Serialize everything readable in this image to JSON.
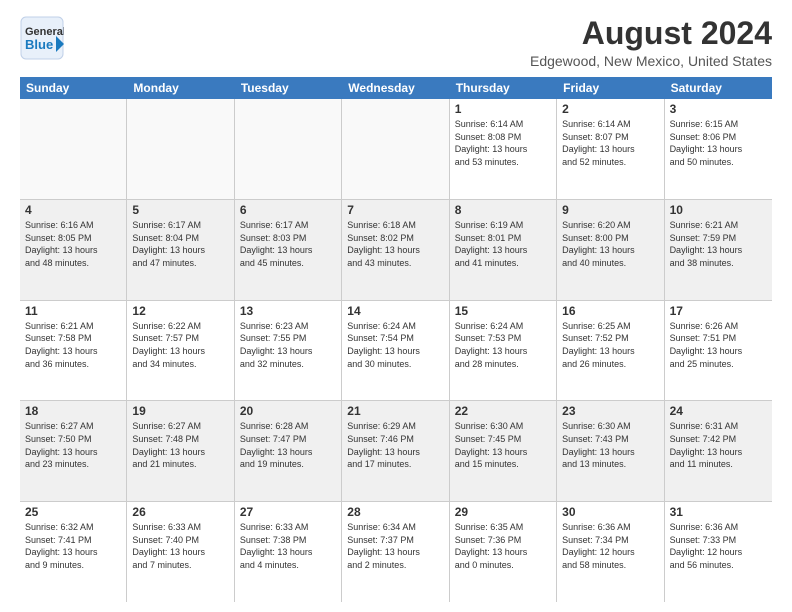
{
  "logo": {
    "line1": "General",
    "line2": "Blue"
  },
  "title": "August 2024",
  "location": "Edgewood, New Mexico, United States",
  "days_of_week": [
    "Sunday",
    "Monday",
    "Tuesday",
    "Wednesday",
    "Thursday",
    "Friday",
    "Saturday"
  ],
  "weeks": [
    [
      {
        "day": "",
        "info": "",
        "empty": true
      },
      {
        "day": "",
        "info": "",
        "empty": true
      },
      {
        "day": "",
        "info": "",
        "empty": true
      },
      {
        "day": "",
        "info": "",
        "empty": true
      },
      {
        "day": "1",
        "info": "Sunrise: 6:14 AM\nSunset: 8:08 PM\nDaylight: 13 hours\nand 53 minutes."
      },
      {
        "day": "2",
        "info": "Sunrise: 6:14 AM\nSunset: 8:07 PM\nDaylight: 13 hours\nand 52 minutes."
      },
      {
        "day": "3",
        "info": "Sunrise: 6:15 AM\nSunset: 8:06 PM\nDaylight: 13 hours\nand 50 minutes."
      }
    ],
    [
      {
        "day": "4",
        "info": "Sunrise: 6:16 AM\nSunset: 8:05 PM\nDaylight: 13 hours\nand 48 minutes."
      },
      {
        "day": "5",
        "info": "Sunrise: 6:17 AM\nSunset: 8:04 PM\nDaylight: 13 hours\nand 47 minutes."
      },
      {
        "day": "6",
        "info": "Sunrise: 6:17 AM\nSunset: 8:03 PM\nDaylight: 13 hours\nand 45 minutes."
      },
      {
        "day": "7",
        "info": "Sunrise: 6:18 AM\nSunset: 8:02 PM\nDaylight: 13 hours\nand 43 minutes."
      },
      {
        "day": "8",
        "info": "Sunrise: 6:19 AM\nSunset: 8:01 PM\nDaylight: 13 hours\nand 41 minutes."
      },
      {
        "day": "9",
        "info": "Sunrise: 6:20 AM\nSunset: 8:00 PM\nDaylight: 13 hours\nand 40 minutes."
      },
      {
        "day": "10",
        "info": "Sunrise: 6:21 AM\nSunset: 7:59 PM\nDaylight: 13 hours\nand 38 minutes."
      }
    ],
    [
      {
        "day": "11",
        "info": "Sunrise: 6:21 AM\nSunset: 7:58 PM\nDaylight: 13 hours\nand 36 minutes."
      },
      {
        "day": "12",
        "info": "Sunrise: 6:22 AM\nSunset: 7:57 PM\nDaylight: 13 hours\nand 34 minutes."
      },
      {
        "day": "13",
        "info": "Sunrise: 6:23 AM\nSunset: 7:55 PM\nDaylight: 13 hours\nand 32 minutes."
      },
      {
        "day": "14",
        "info": "Sunrise: 6:24 AM\nSunset: 7:54 PM\nDaylight: 13 hours\nand 30 minutes."
      },
      {
        "day": "15",
        "info": "Sunrise: 6:24 AM\nSunset: 7:53 PM\nDaylight: 13 hours\nand 28 minutes."
      },
      {
        "day": "16",
        "info": "Sunrise: 6:25 AM\nSunset: 7:52 PM\nDaylight: 13 hours\nand 26 minutes."
      },
      {
        "day": "17",
        "info": "Sunrise: 6:26 AM\nSunset: 7:51 PM\nDaylight: 13 hours\nand 25 minutes."
      }
    ],
    [
      {
        "day": "18",
        "info": "Sunrise: 6:27 AM\nSunset: 7:50 PM\nDaylight: 13 hours\nand 23 minutes."
      },
      {
        "day": "19",
        "info": "Sunrise: 6:27 AM\nSunset: 7:48 PM\nDaylight: 13 hours\nand 21 minutes."
      },
      {
        "day": "20",
        "info": "Sunrise: 6:28 AM\nSunset: 7:47 PM\nDaylight: 13 hours\nand 19 minutes."
      },
      {
        "day": "21",
        "info": "Sunrise: 6:29 AM\nSunset: 7:46 PM\nDaylight: 13 hours\nand 17 minutes."
      },
      {
        "day": "22",
        "info": "Sunrise: 6:30 AM\nSunset: 7:45 PM\nDaylight: 13 hours\nand 15 minutes."
      },
      {
        "day": "23",
        "info": "Sunrise: 6:30 AM\nSunset: 7:43 PM\nDaylight: 13 hours\nand 13 minutes."
      },
      {
        "day": "24",
        "info": "Sunrise: 6:31 AM\nSunset: 7:42 PM\nDaylight: 13 hours\nand 11 minutes."
      }
    ],
    [
      {
        "day": "25",
        "info": "Sunrise: 6:32 AM\nSunset: 7:41 PM\nDaylight: 13 hours\nand 9 minutes."
      },
      {
        "day": "26",
        "info": "Sunrise: 6:33 AM\nSunset: 7:40 PM\nDaylight: 13 hours\nand 7 minutes."
      },
      {
        "day": "27",
        "info": "Sunrise: 6:33 AM\nSunset: 7:38 PM\nDaylight: 13 hours\nand 4 minutes."
      },
      {
        "day": "28",
        "info": "Sunrise: 6:34 AM\nSunset: 7:37 PM\nDaylight: 13 hours\nand 2 minutes."
      },
      {
        "day": "29",
        "info": "Sunrise: 6:35 AM\nSunset: 7:36 PM\nDaylight: 13 hours\nand 0 minutes."
      },
      {
        "day": "30",
        "info": "Sunrise: 6:36 AM\nSunset: 7:34 PM\nDaylight: 12 hours\nand 58 minutes."
      },
      {
        "day": "31",
        "info": "Sunrise: 6:36 AM\nSunset: 7:33 PM\nDaylight: 12 hours\nand 56 minutes."
      }
    ]
  ]
}
